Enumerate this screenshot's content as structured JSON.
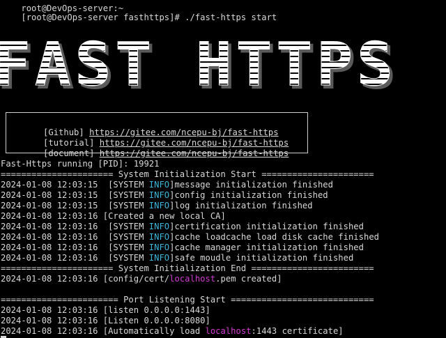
{
  "terminal": {
    "top_partial": "root@DevOps-server:~",
    "prompt": "[root@DevOps-server fasthttps]# ",
    "command": "./fast-https start",
    "banner_text": "FAST HTTPS",
    "info_box": [
      {
        "label": "[Github] ",
        "url": "https://gitee.com/ncepu-bj/fast-https"
      },
      {
        "label": "[tutorial] ",
        "url": "https://gitee.com/ncepu-bj/fast-https"
      },
      {
        "label": "[document] ",
        "url": "https://gitee.com/ncepu-bj/fast-https"
      }
    ],
    "running_line": "Fast-Https running [PID]: 19921",
    "sys_init_start": "====================== System Initialization Start ======================",
    "sys_init_end": "====================== System Initialization End ========================",
    "port_start": "======================= Port Listening Start ============================",
    "log_lines": [
      {
        "ts": "2024-01-08 12:03:15 ",
        "pre": " [SYSTEM ",
        "tag": "INFO",
        "post": "]message initialization finished"
      },
      {
        "ts": "2024-01-08 12:03:15 ",
        "pre": " [SYSTEM ",
        "tag": "INFO",
        "post": "]config initialization finished"
      },
      {
        "ts": "2024-01-08 12:03:15 ",
        "pre": " [SYSTEM ",
        "tag": "INFO",
        "post": "]log initialization finished"
      },
      {
        "ts": "2024-01-08 12:03:16 ",
        "pre": "[Created a new local CA]",
        "tag": "",
        "post": ""
      },
      {
        "ts": "2024-01-08 12:03:16 ",
        "pre": " [SYSTEM ",
        "tag": "INFO",
        "post": "]certification initialization finished"
      },
      {
        "ts": "2024-01-08 12:03:16 ",
        "pre": " [SYSTEM ",
        "tag": "INFO",
        "post": "]cache loadcache load disk cache finished"
      },
      {
        "ts": "2024-01-08 12:03:16 ",
        "pre": " [SYSTEM ",
        "tag": "INFO",
        "post": "]cache manager initialization finished"
      },
      {
        "ts": "2024-01-08 12:03:16 ",
        "pre": " [SYSTEM ",
        "tag": "INFO",
        "post": "]safe moudle initialization finished"
      }
    ],
    "cert_line": {
      "ts": "2024-01-08 12:03:16 ",
      "pre": "[config/cert/",
      "host": "localhost",
      "post": ".pem created]"
    },
    "listen_lines": [
      {
        "ts": "2024-01-08 12:03:16 ",
        "text": "[listen 0.0.0.0:1443]"
      },
      {
        "ts": "2024-01-08 12:03:16 ",
        "text": "[Listen 0.0.0.0:8080]"
      }
    ],
    "auto_line": {
      "ts": "2024-01-08 12:03:16 ",
      "pre": "[Automatically load ",
      "host": "localhost",
      "post": ":1443 certificate]"
    },
    "colors": {
      "background": "#000000",
      "text": "#d8d8d8",
      "info": "#3cb6d8",
      "host": "#d23ccf"
    }
  }
}
